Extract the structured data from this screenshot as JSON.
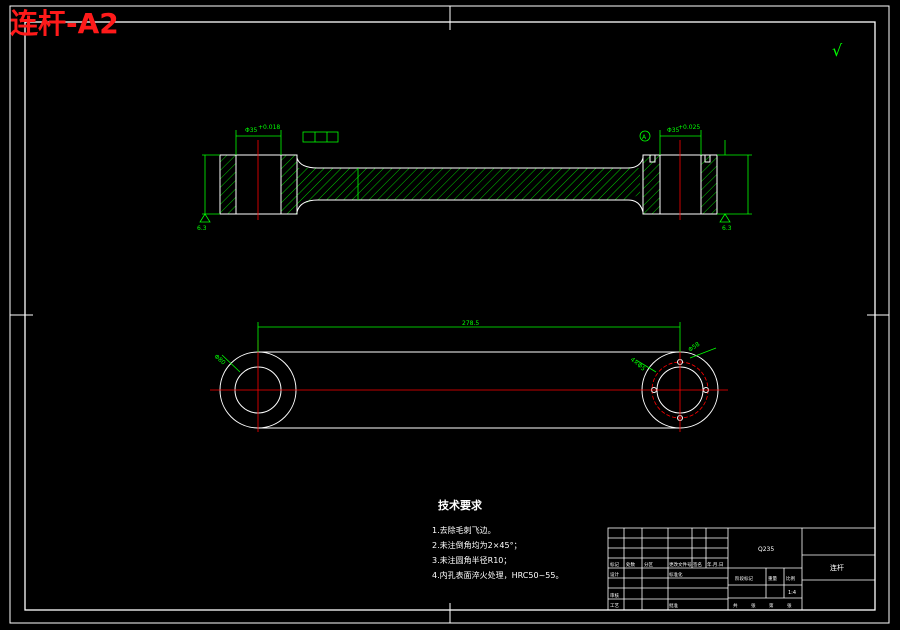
{
  "drawing_title": "连杆-A2",
  "check_mark": "√",
  "tech_requirements": {
    "heading": "技术要求",
    "items": [
      "1.去除毛刺飞边。",
      "2.未注倒角均为2×45°；",
      "3.未注圆角半径R10；",
      "4.内孔表面淬火处理，HRC50~55。"
    ]
  },
  "dimensions": {
    "center_distance": "278.5",
    "left_tolerance": "+0.018",
    "right_tolerance": "+0.025",
    "datum": "A"
  },
  "title_block": {
    "material": "Q235",
    "part_name": "连杆",
    "scale": "1:4",
    "cells": [
      "标记",
      "处数",
      "分区",
      "更改文件号",
      "签名",
      "年.月.日",
      "设计",
      "标准化",
      "审核",
      "工艺",
      "批准",
      "阶段标记",
      "重量",
      "比例",
      "共",
      "张",
      "第",
      "张"
    ]
  },
  "colors": {
    "outline": "#ffffff",
    "dimension": "#00ff00",
    "centerline": "#ff0000",
    "hatch": "#00ff00",
    "title": "#ff1a1a"
  }
}
